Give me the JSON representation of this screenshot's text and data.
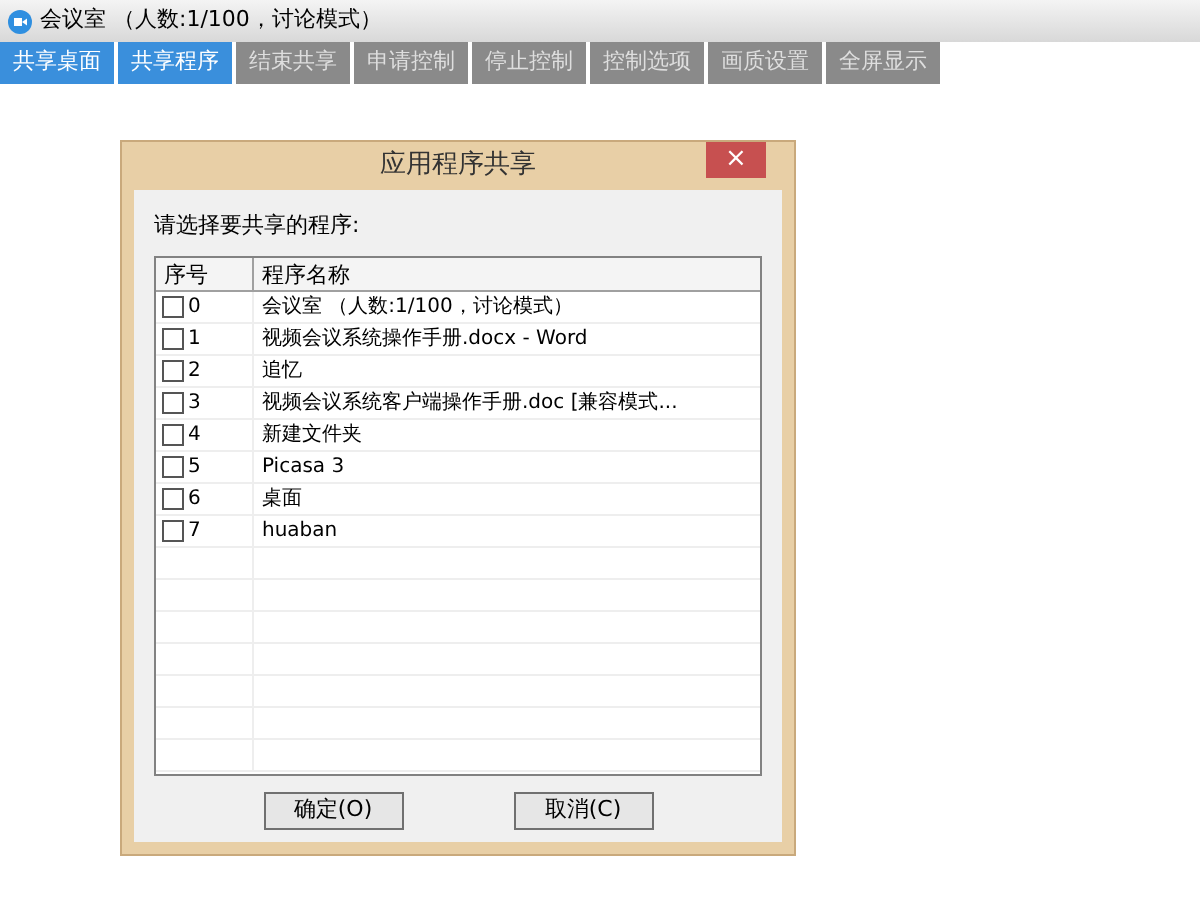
{
  "window": {
    "title": "会议室 （人数:1/100，讨论模式）"
  },
  "toolbar": [
    {
      "label": "共享桌面",
      "disabled": false
    },
    {
      "label": "共享程序",
      "disabled": false
    },
    {
      "label": "结束共享",
      "disabled": true
    },
    {
      "label": "申请控制",
      "disabled": true
    },
    {
      "label": "停止控制",
      "disabled": true
    },
    {
      "label": "控制选项",
      "disabled": true
    },
    {
      "label": "画质设置",
      "disabled": true
    },
    {
      "label": "全屏显示",
      "disabled": true
    }
  ],
  "dialog": {
    "title": "应用程序共享",
    "close": "×",
    "prompt": "请选择要共享的程序:",
    "table": {
      "columns": [
        "序号",
        "程序名称"
      ],
      "rows": [
        {
          "index": "0",
          "name": "会议室 （人数:1/100，讨论模式）",
          "checked": false
        },
        {
          "index": "1",
          "name": "视频会议系统操作手册.docx - Word",
          "checked": false
        },
        {
          "index": "2",
          "name": "追忆",
          "checked": false
        },
        {
          "index": "3",
          "name": "视频会议系统客户端操作手册.doc [兼容模式...",
          "checked": false
        },
        {
          "index": "4",
          "name": "新建文件夹",
          "checked": false
        },
        {
          "index": "5",
          "name": "Picasa 3",
          "checked": false
        },
        {
          "index": "6",
          "name": "桌面",
          "checked": false
        },
        {
          "index": "7",
          "name": "huaban",
          "checked": false
        }
      ]
    },
    "buttons": [
      "确定(O)",
      "取消(C)"
    ]
  }
}
